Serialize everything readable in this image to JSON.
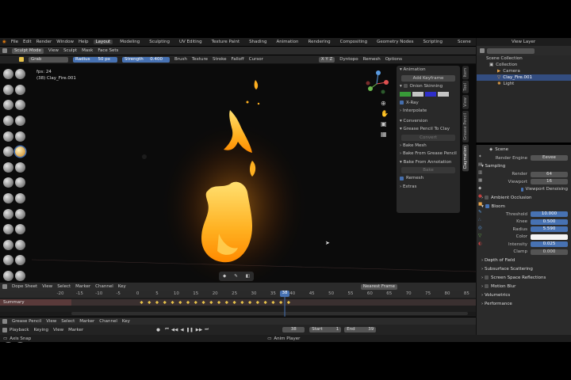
{
  "topbar": {
    "menus": [
      "File",
      "Edit",
      "Render",
      "Window",
      "Help"
    ],
    "workspaces": [
      "Layout",
      "Modeling",
      "Sculpting",
      "UV Editing",
      "Texture Paint",
      "Shading",
      "Animation",
      "Rendering",
      "Compositing",
      "Geometry Nodes",
      "Scripting"
    ],
    "active_workspace": "Layout",
    "scene": "Scene",
    "view_layer": "View Layer"
  },
  "header": {
    "mode": "Sculpt Mode",
    "menus": [
      "View",
      "Sculpt",
      "Mask",
      "Face Sets"
    ],
    "brush_name": "Grab",
    "radius_label": "Radius",
    "radius_value": "50 px",
    "strength_label": "Strength",
    "strength_value": "0.400",
    "dropdowns": [
      "Brush",
      "Texture",
      "Stroke",
      "Falloff",
      "Cursor"
    ],
    "right": [
      "Dyntopo",
      "Remesh",
      "Options"
    ]
  },
  "viewport": {
    "fps": "fps: 24",
    "object": "(38) Clay_Fire.001"
  },
  "sidepanel": {
    "animation": "Animation",
    "add_keyframe": "Add Keyframe",
    "onion": "Onion Skinning",
    "xray": "X-Ray",
    "interpolate": "Interpolate",
    "conversion": "Conversion",
    "gp_to_clay": "Grease Pencil To Clay",
    "convert": "Convert",
    "bake_mesh": "Bake Mesh",
    "bake_from_gp": "Bake From Grease Pencil",
    "bake_from_anim": "Bake From Annotation",
    "bake": "Bake",
    "remesh": "Remesh",
    "extras": "Extras"
  },
  "vtabs": [
    "Item",
    "Tool",
    "View",
    "Grease Pencil",
    "Claymation"
  ],
  "outliner": {
    "rows": [
      "Scene Collection",
      "Collection",
      "Camera",
      "Clay_Fire.001",
      "Light"
    ]
  },
  "properties": {
    "scene": "Scene",
    "render_engine_label": "Render Engine",
    "render_engine": "Eevee",
    "sampling": "Sampling",
    "render_label": "Render",
    "render_val": "64",
    "viewport_label": "Viewport",
    "viewport_val": "16",
    "denoise": "Viewport Denoising",
    "ao": "Ambient Occlusion",
    "bloom": "Bloom",
    "threshold_label": "Threshold",
    "threshold_val": "10.000",
    "knee_label": "Knee",
    "knee_val": "0.500",
    "radius_label": "Radius",
    "radius_val": "5.590",
    "color_label": "Color",
    "intensity_label": "Intensity",
    "intensity_val": "0.025",
    "clamp_label": "Clamp",
    "clamp_val": "0.000",
    "sections": [
      "Depth of Field",
      "Subsurface Scattering",
      "Screen Space Reflections",
      "Motion Blur",
      "Volumetrics",
      "Performance"
    ]
  },
  "dopesheet": {
    "editor": "Dope Sheet",
    "menus": [
      "View",
      "Select",
      "Marker",
      "Channel",
      "Key"
    ],
    "nearest_frame": "Nearest Frame",
    "summary": "Summary",
    "ticks": [
      "-20",
      "-15",
      "-10",
      "-5",
      "0",
      "5",
      "10",
      "15",
      "20",
      "25",
      "30",
      "35",
      "40",
      "45",
      "50",
      "55",
      "60",
      "65",
      "70",
      "75",
      "80",
      "85"
    ],
    "current_frame": "38"
  },
  "timeline": {
    "editor": "Grease Pencil",
    "menus": [
      "View",
      "Select",
      "Marker",
      "Channel",
      "Key"
    ],
    "playback": "Playback",
    "keying": "Keying",
    "view": "View",
    "marker": "Marker",
    "frame": "38",
    "start_label": "Start",
    "start": "1",
    "end_label": "End",
    "end": "39"
  },
  "status": {
    "left": "Axis Snap",
    "center": "Anim Player"
  },
  "colors": {
    "accent": "#4772b3",
    "frame": "#4772b3",
    "keyframe": "#e8c34a"
  }
}
